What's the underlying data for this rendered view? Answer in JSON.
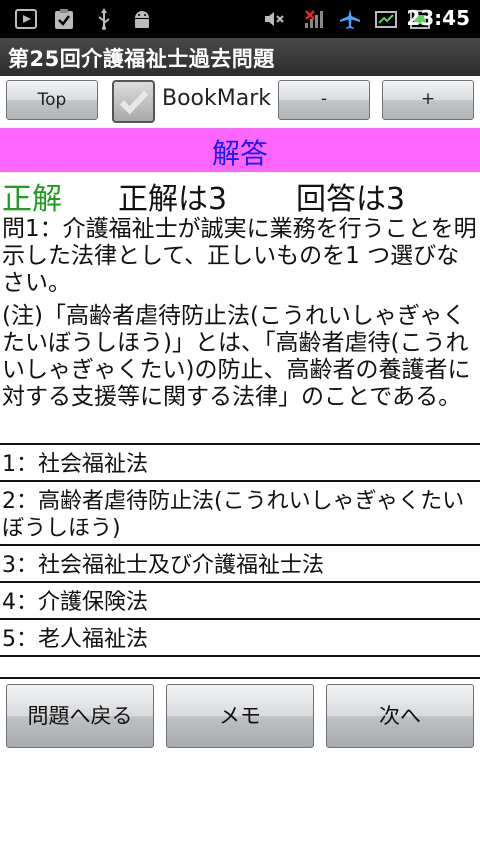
{
  "status_bar": {
    "time": "23:45",
    "icons": [
      "play-store-icon",
      "clipboard-check-icon",
      "usb-icon",
      "android-debug-icon",
      "mute-icon",
      "no-signal-icon",
      "airplane-mode-icon",
      "battery-icon"
    ]
  },
  "title_bar": {
    "title": "第25回介護福祉士過去問題"
  },
  "toolbar": {
    "top_label": "Top",
    "bookmark_label": "BookMark",
    "minus_label": "-",
    "plus_label": "+"
  },
  "answer_header": {
    "label": "解答"
  },
  "result": {
    "judge": "正解",
    "correct_text": "正解は3",
    "user_text": "回答は3",
    "judge_color": "#1f9b1f"
  },
  "question": {
    "text": "問1：介護福祉士が誠実に業務を行うことを明示した法律として、正しいものを1 つ選びなさい。",
    "note": "(注)「高齢者虐待防止法(こうれいしゃぎゃくたいぼうしほう)」とは、「高齢者虐待(こうれいしゃぎゃくたい)の防止、高齢者の養護者に対する支援等に関する法律」のことである。"
  },
  "choices": [
    "1：社会福祉法",
    "2：高齢者虐待防止法(こうれいしゃぎゃくたいぼうしほう)",
    "3：社会福祉士及び介護福祉士法",
    "4：介護保険法",
    "5：老人福祉法"
  ],
  "bottom_buttons": {
    "back": "問題へ戻る",
    "memo": "メモ",
    "next": "次へ"
  },
  "colors": {
    "answer_header_bg": "#ff66ff",
    "answer_header_text": "#1a1aff"
  }
}
